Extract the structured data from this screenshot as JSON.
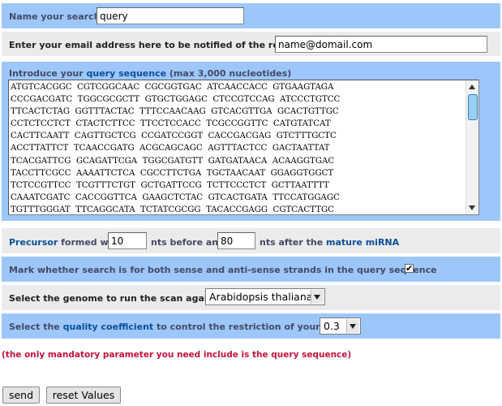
{
  "search_name": {
    "label": "Name your search",
    "value": "query"
  },
  "email": {
    "label": "Enter your email address here to be notified of the results",
    "value": "name@domail.com"
  },
  "sequence": {
    "label_prefix": "Introduce your ",
    "label_link": "query sequence",
    "label_suffix": " (max 3,000 nucleotides)",
    "lines": [
      "ATGTCACGGC  CGTCGGCAAC  CGCGGTGAC  ATCAACCACC  GTGAAGTAGA",
      "CCCGACGATC  TGGCGCGCTT  GTGCTGGAGC  CTCCGTCCAG  ATCCCTGTCC",
      "TTCACTCTAG  GGTTTACTAC  TTTCCAACAAG  GTCACGTTGA  GCACTGTTGC",
      "CCTCTCCTCT  CTACTCTTCC  TTCCTCCACC  TCGCCGGTTC  CATGTATCAT",
      "CACTTCAATT  CAGTTGCTCG  CCGATCCGGT  CACCGACGAG  GTCTTTGCTC",
      "ACCTTATTCT  TCAACCGATG  ACGCAGCAGC  AGTTTACTCC  GACTAATTAT",
      "TCACGATTCG  GCAGATTCGA  TGGCGATGTT  GATGATAACA  ACAAGGTGAC",
      "TACCTTCGCC  AAAATTCTCA  CGCCTTCTGA  TGCTAACAAT  GGAGGTGGCT",
      "TCTCCGTTCC  TCGTTTCTGT  GCTGATTCCG  TCTTCCCTCT  GCTTAATTTT",
      "CAAATCGATC  CACCGGTTCA  GAAGCTCTAC  GTCACTGATA  TTCCATGGAGC",
      "TGTTTGGGAT  TTCAGGCATA  TCTATCGCGG  TACACCGAGG  CGTCACTTGC"
    ]
  },
  "precursor": {
    "link": "Precursor",
    "text_formed": " formed with",
    "before_value": "10",
    "text_before": "nts before and",
    "after_value": "80",
    "text_after": "nts after the ",
    "link2": "mature miRNA"
  },
  "strands": {
    "label": "Mark whether search is for both sense and anti-sense strands in the query sequence",
    "checked": "✔"
  },
  "genome": {
    "label": "Select the genome to run the scan against",
    "selected": "Arabidopsis thaliana"
  },
  "quality": {
    "label_prefix": "Select the ",
    "label_link": "quality coefficient",
    "label_suffix": " to control the restriction of your search",
    "selected": "0.3"
  },
  "note": "(the only mandatory parameter you need include is the query sequence)",
  "buttons": {
    "send": "send",
    "reset": "reset Values"
  },
  "colors": {
    "band_blue": "#9dc7fa",
    "band_gray": "#ebebeb",
    "link": "#0a4f9a",
    "note_red": "#c4123c"
  }
}
